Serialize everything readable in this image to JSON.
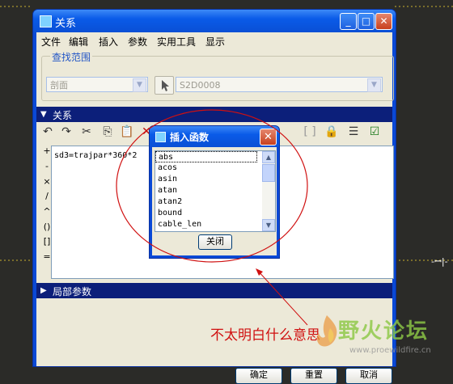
{
  "window": {
    "title": "关系"
  },
  "menu": [
    "文件",
    "编辑",
    "插入",
    "参数",
    "实用工具",
    "显示"
  ],
  "search_scope": {
    "label": "查找范围",
    "type_value": "剖面",
    "item_value": "S2D0008"
  },
  "relations_section": {
    "label": "关系"
  },
  "operators": [
    "+",
    "-",
    "×",
    "/",
    "^",
    "()",
    "[]",
    "="
  ],
  "editor": {
    "text": "sd3=trajpar*360*2"
  },
  "local_params": {
    "label": "局部参数"
  },
  "buttons": {
    "ok": "确定",
    "reset": "重置",
    "cancel": "取消"
  },
  "dialog": {
    "title": "插入函数",
    "functions": [
      "abs",
      "acos",
      "asin",
      "atan",
      "atan2",
      "bound",
      "cable_len"
    ],
    "close_label": "关闭"
  },
  "annotation": "不太明白什么意思",
  "watermark": {
    "text": "野火论坛",
    "url": "www.proewildfire.cn"
  },
  "colors": {
    "annotation": "#d01010",
    "section_bar": "#0c1f7a",
    "xp_title": "#0a5be8"
  }
}
